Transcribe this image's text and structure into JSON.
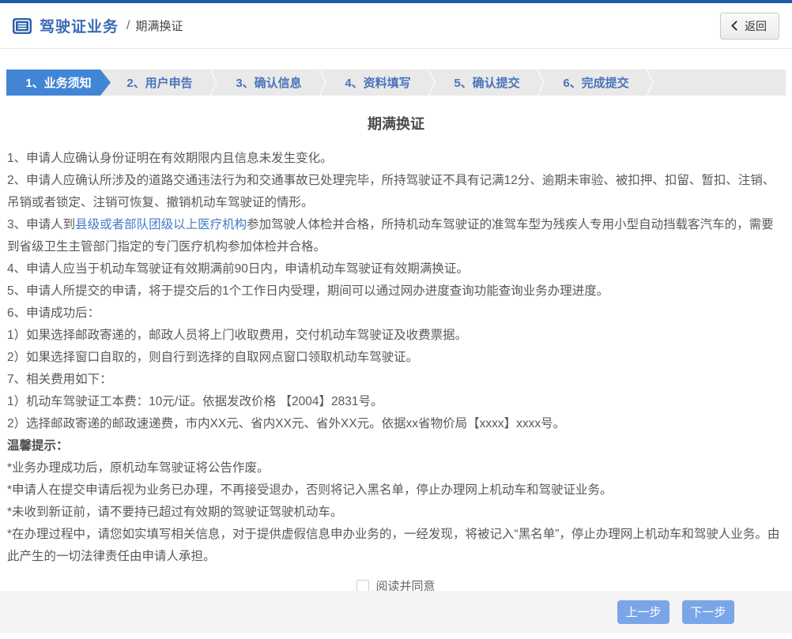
{
  "header": {
    "section_title": "驾驶证业务",
    "separator": "/",
    "page_name": "期满换证",
    "back_button": {
      "label": "返回"
    }
  },
  "steps": [
    {
      "label": "1、业务须知",
      "active": true
    },
    {
      "label": "2、用户申告",
      "active": false
    },
    {
      "label": "3、确认信息",
      "active": false
    },
    {
      "label": "4、资料填写",
      "active": false
    },
    {
      "label": "5、确认提交",
      "active": false
    },
    {
      "label": "6、完成提交",
      "active": false
    }
  ],
  "notice": {
    "title": "期满换证",
    "lines": [
      {
        "parts": [
          {
            "t": "1、申请人应确认身份证明在有效期限内且信息未发生变化。"
          }
        ]
      },
      {
        "parts": [
          {
            "t": "2、申请人应确认所涉及的道路交通违法行为和交通事故已处理完毕，所持驾驶证不具有记满12分、逾期未审验、被扣押、扣留、暂扣、注销、吊销或者锁定、注销可恢复、撤销机动车驾驶证的情形。"
          }
        ]
      },
      {
        "parts": [
          {
            "t": "3、申请人到"
          },
          {
            "t": "县级或者部队团级以上医疗机构",
            "s": "link"
          },
          {
            "t": "参加驾驶人体检并合格，所持机动车驾驶证的准驾车型为残疾人专用小型自动挡载客汽车的，需要到省级卫生主管部门指定的专门医疗机构参加体检并合格。"
          }
        ]
      },
      {
        "parts": [
          {
            "t": "4、申请人应当于机动车驾驶证有效期满前90日内，申请机动车驾驶证有效期满换证。"
          }
        ]
      },
      {
        "parts": [
          {
            "t": "5、申请人所提交的申请，将于提交后的1个工作日内受理，期间可以通过网办进度查询功能查询业务办理进度。"
          }
        ]
      },
      {
        "parts": [
          {
            "t": "6、申请成功后："
          }
        ]
      },
      {
        "parts": [
          {
            "t": "1）如果选择邮政寄递的，邮政人员将上门收取费用，交付机动车驾驶证及收费票据。"
          }
        ]
      },
      {
        "parts": [
          {
            "t": "2）如果选择窗口自取的，则自行到选择的自取网点窗口领取机动车驾驶证。"
          }
        ]
      },
      {
        "parts": [
          {
            "t": "7、相关费用如下："
          }
        ]
      },
      {
        "parts": [
          {
            "t": "1）机动车驾驶证工本费：10元/证。依据发改价格 【2004】2831号。"
          }
        ]
      },
      {
        "parts": [
          {
            "t": "2）选择邮政寄递的邮政速递费，市内XX元、省内XX元、省外XX元。依据xx省物价局【xxxx】xxxx号。"
          }
        ]
      },
      {
        "parts": [
          {
            "t": "温馨提示：",
            "s": "bold"
          }
        ]
      },
      {
        "parts": [
          {
            "t": "*业务办理成功后，原机动车驾驶证将公告作废。"
          }
        ]
      },
      {
        "parts": [
          {
            "t": "*申请人在提交申请后视为业务已办理，不再接受退办，否则将记入黑名单，停止办理网上机动车和驾驶证业务。"
          }
        ]
      },
      {
        "parts": [
          {
            "t": "*未收到新证前，请不要持已超过有效期的驾驶证驾驶机动车。"
          }
        ]
      },
      {
        "parts": [
          {
            "t": "*在办理过程中，请您如实填写相关信息，对于提供虚假信息申办业务的，一经发现，将被记入“黑名单”，停止办理网上机动车和驾驶人业务。由此产生的一切法律责任由申请人承担。"
          }
        ]
      }
    ],
    "agree": {
      "checked": false,
      "label": "阅读并同意"
    }
  },
  "footer": {
    "prev_label": "上一步",
    "next_label": "下一步"
  },
  "colors": {
    "topbar_blue": "#1c5ba6",
    "active_step_blue": "#4285d5",
    "step_text_blue": "#4a74ba",
    "link_blue": "#4a79c4",
    "button_blue": "#7aa6e8",
    "stepbar_gray": "#e9e9e9",
    "footer_gray": "#f4f4f4",
    "body_text": "#595959"
  }
}
